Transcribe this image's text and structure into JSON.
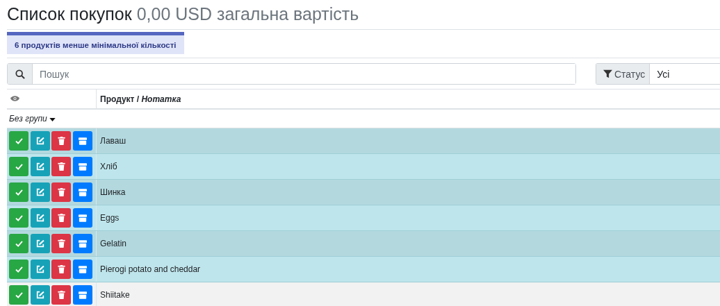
{
  "title": "Список покупок",
  "subtitle": "0,00 USD загальна вартість",
  "alert": "6 продуктів менше мінімальної кількості",
  "search": {
    "placeholder": "Пошук"
  },
  "status_filter": {
    "label": "Статус",
    "value": "Усі"
  },
  "table": {
    "columns": [
      {
        "label": "Продукт / *Нотатка*"
      }
    ],
    "group": "Без групи",
    "rows": [
      {
        "product": "Лаваш",
        "below_min": true
      },
      {
        "product": "Хліб",
        "below_min": true
      },
      {
        "product": "Шинка",
        "below_min": true
      },
      {
        "product": "Eggs",
        "below_min": true
      },
      {
        "product": "Gelatin",
        "below_min": true
      },
      {
        "product": "Pierogi potato and cheddar",
        "below_min": true
      },
      {
        "product": "Shiitake",
        "below_min": false
      }
    ]
  }
}
